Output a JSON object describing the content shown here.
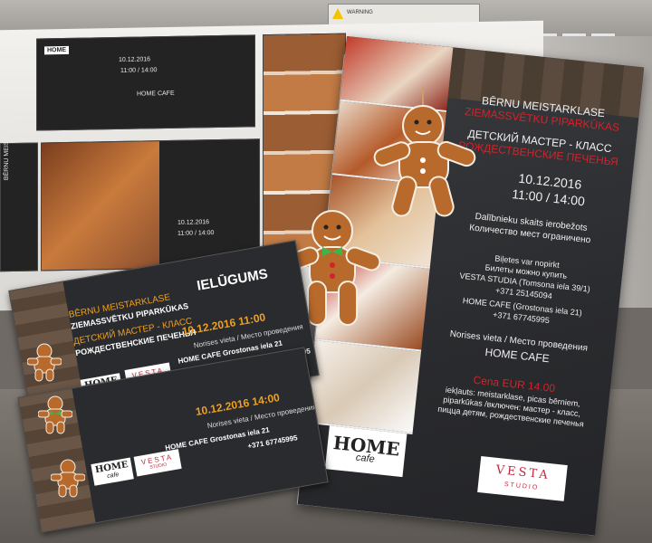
{
  "printer": {
    "label_text": "WARNING"
  },
  "roll": {
    "logo": "HOME",
    "title": "BĒRNU MEISTARKLASE",
    "date": "10.12.2016",
    "time": "11:00 / 14:00",
    "venue": "HOME CAFE"
  },
  "flyer": {
    "title_lv": "BĒRNU MEISTARKLASE",
    "subtitle_lv": "ZIEMASSVĒTKU PIPARKŪKAS",
    "title_ru": "ДЕТСКИЙ МАСТЕР - КЛАСС",
    "subtitle_ru": "РОЖДЕСТВЕНСКИЕ ПЕЧЕНЬЯ",
    "date": "10.12.2016",
    "time": "11:00 / 14:00",
    "limited_lv": "Dalībnieku skaits ierobežots",
    "limited_ru": "Количество мест ограничено",
    "tickets_lv": "Biļetes var nopirkt",
    "tickets_ru": "Билеты можно купить",
    "vesta_addr": "VESTA STUDIA (Tomsona iela 39/1)",
    "vesta_phone": "+371 25145094",
    "home_addr": "HOME CAFE (Grostonas iela 21)",
    "home_phone": "+371 67745995",
    "venue_label": "Norises vieta / Место проведения",
    "venue": "HOME CAFE",
    "price": "Cena EUR 14.00",
    "included_1": "iekļauts: meistarklase, picas bērniem,",
    "included_2": "piparkūkas /включен: мастер - класс,",
    "included_3": "пицца детям, рождественские печенья",
    "logo_home": "HOME",
    "logo_home_sub": "cafe",
    "logo_vesta": "VESTA",
    "logo_vesta_sub": "STUDIO"
  },
  "invitation": {
    "title_lv": "BĒRNU MEISTARKLASE",
    "header": "IELŪGUMS",
    "subtitle_lv": "ZIEMASSVĒTKU PIPARKŪKAS",
    "title_ru": "ДЕТСКИЙ МАСТЕР - КЛАСС",
    "subtitle_ru": "РОЖДЕСТВЕНСКИЕ ПЕЧЕНЬЯ",
    "date_time_1": "10.12.2016  11:00",
    "date_time_2": "10.12.2016  14:00",
    "venue_label": "Norises vieta / Место проведения",
    "address": "HOME CAFE  Grostonas iela 21",
    "phone": "+371 67745995",
    "logo_home": "HOME",
    "logo_home_sub": "cafe",
    "logo_vesta": "VESTA",
    "logo_vesta_sub": "STUDIO"
  },
  "colors": {
    "accent_red": "#d2232a",
    "accent_orange": "#f0a020",
    "dark_bg": "#2a2b2e",
    "gingerbread": "#b8692c"
  }
}
